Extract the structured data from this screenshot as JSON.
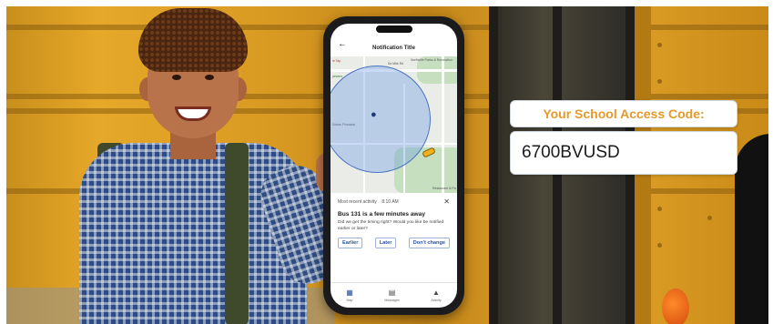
{
  "colors": {
    "accent_orange": "#e59a2b",
    "app_blue": "#2952a3",
    "bus_yellow": "#e6a829"
  },
  "phone": {
    "header": {
      "title": "Notification Title",
      "back_icon": "arrow-left-icon"
    },
    "map": {
      "labels": [
        "Se Mile Rd",
        "Northville Parks & Recreation",
        "Restaurant & Pa"
      ],
      "poi_labels": [
        "le Tap",
        "jrewers",
        "Sobas Financial"
      ],
      "pin_icon": "map-pin-icon",
      "bus_icon": "bus-marker-icon"
    },
    "notification": {
      "activity_label": "Most recent activity",
      "time": "8:10 AM",
      "headline": "Bus 131 is a few minutes away",
      "body": "Did we get the timing right? Would you like be notified earlier or later?",
      "buttons": [
        "Earlier",
        "Later",
        "Don't change"
      ],
      "close_icon": "close-icon"
    },
    "tabs": [
      {
        "label": "Map",
        "icon": "map-icon",
        "active": true
      },
      {
        "label": "Messages",
        "icon": "chat-icon",
        "active": false
      },
      {
        "label": "Activity",
        "icon": "bell-icon",
        "active": false
      }
    ]
  },
  "access": {
    "title": "Your School Access Code:",
    "code": "6700BVUSD"
  }
}
